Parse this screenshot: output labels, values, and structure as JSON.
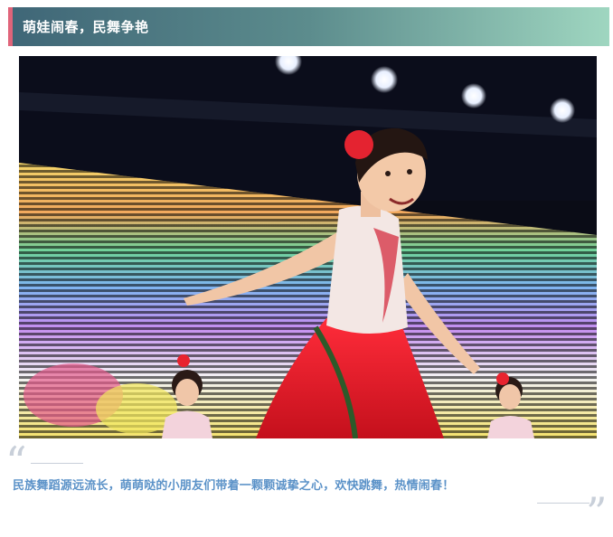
{
  "header": {
    "title": "萌娃闹春，民舞争艳"
  },
  "photo": {
    "subject": "dancer-photo"
  },
  "caption": {
    "text": "民族舞蹈源远流长，萌萌哒的小朋友们带着一颗颗诚挚之心，欢快跳舞，热情闹春！",
    "open_quote": "“",
    "close_quote": "”"
  },
  "colors": {
    "header_start": "#3f6677",
    "header_end": "#9fd6c0",
    "accent": "#e0647a",
    "caption": "#5b92c8",
    "quote": "#c8cfd9"
  }
}
